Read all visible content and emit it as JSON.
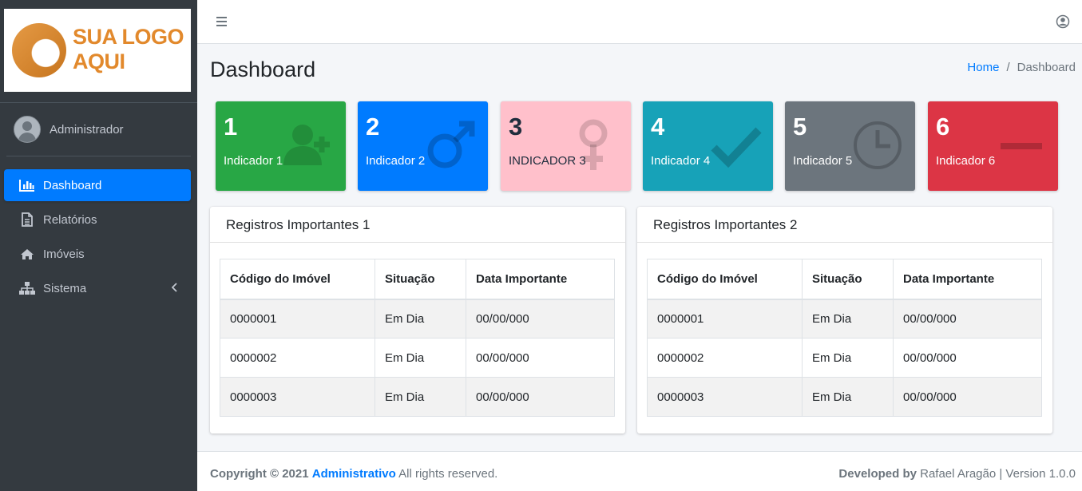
{
  "logo": {
    "line1": "SUA LOGO",
    "line2": "AQUI"
  },
  "user": {
    "name": "Administrador"
  },
  "sidebar": {
    "items": [
      {
        "label": "Dashboard",
        "icon": "chart-bar-icon",
        "active": true
      },
      {
        "label": "Relatórios",
        "icon": "file-text-icon"
      },
      {
        "label": "Imóveis",
        "icon": "home-icon"
      },
      {
        "label": "Sistema",
        "icon": "sitemap-icon",
        "caret": "‹"
      }
    ]
  },
  "header": {
    "title": "Dashboard",
    "breadcrumb": {
      "home": "Home",
      "separator": "/",
      "current": "Dashboard"
    }
  },
  "indicators": [
    {
      "number": "1",
      "label": "Indicador 1",
      "color": "#28a745",
      "icon": "user-plus-icon"
    },
    {
      "number": "2",
      "label": "Indicador 2",
      "color": "#007bff",
      "icon": "mars-icon"
    },
    {
      "number": "3",
      "label": "INDICADOR 3",
      "color": "#ffc0cb",
      "icon": "venus-icon"
    },
    {
      "number": "4",
      "label": "Indicador 4",
      "color": "#17a2b8",
      "icon": "check-icon"
    },
    {
      "number": "5",
      "label": "Indicador 5",
      "color": "#6c757d",
      "icon": "clock-icon"
    },
    {
      "number": "6",
      "label": "Indicador 6",
      "color": "#dc3545",
      "icon": "minus-icon"
    }
  ],
  "cards": [
    {
      "title": "Registros Importantes 1",
      "columns": [
        "Código do Imóvel",
        "Situação",
        "Data Importante"
      ],
      "rows": [
        [
          "0000001",
          "Em Dia",
          "00/00/000"
        ],
        [
          "0000002",
          "Em Dia",
          "00/00/000"
        ],
        [
          "0000003",
          "Em Dia",
          "00/00/000"
        ]
      ]
    },
    {
      "title": "Registros Importantes 2",
      "columns": [
        "Código do Imóvel",
        "Situação",
        "Data Importante"
      ],
      "rows": [
        [
          "0000001",
          "Em Dia",
          "00/00/000"
        ],
        [
          "0000002",
          "Em Dia",
          "00/00/000"
        ],
        [
          "0000003",
          "Em Dia",
          "00/00/000"
        ]
      ]
    }
  ],
  "footer": {
    "copyright": "Copyright © 2021",
    "brand": "Administrativo",
    "rights": "All rights reserved.",
    "developed_by": "Developed by",
    "author": "Rafael Aragão | Version 1.0.0"
  }
}
